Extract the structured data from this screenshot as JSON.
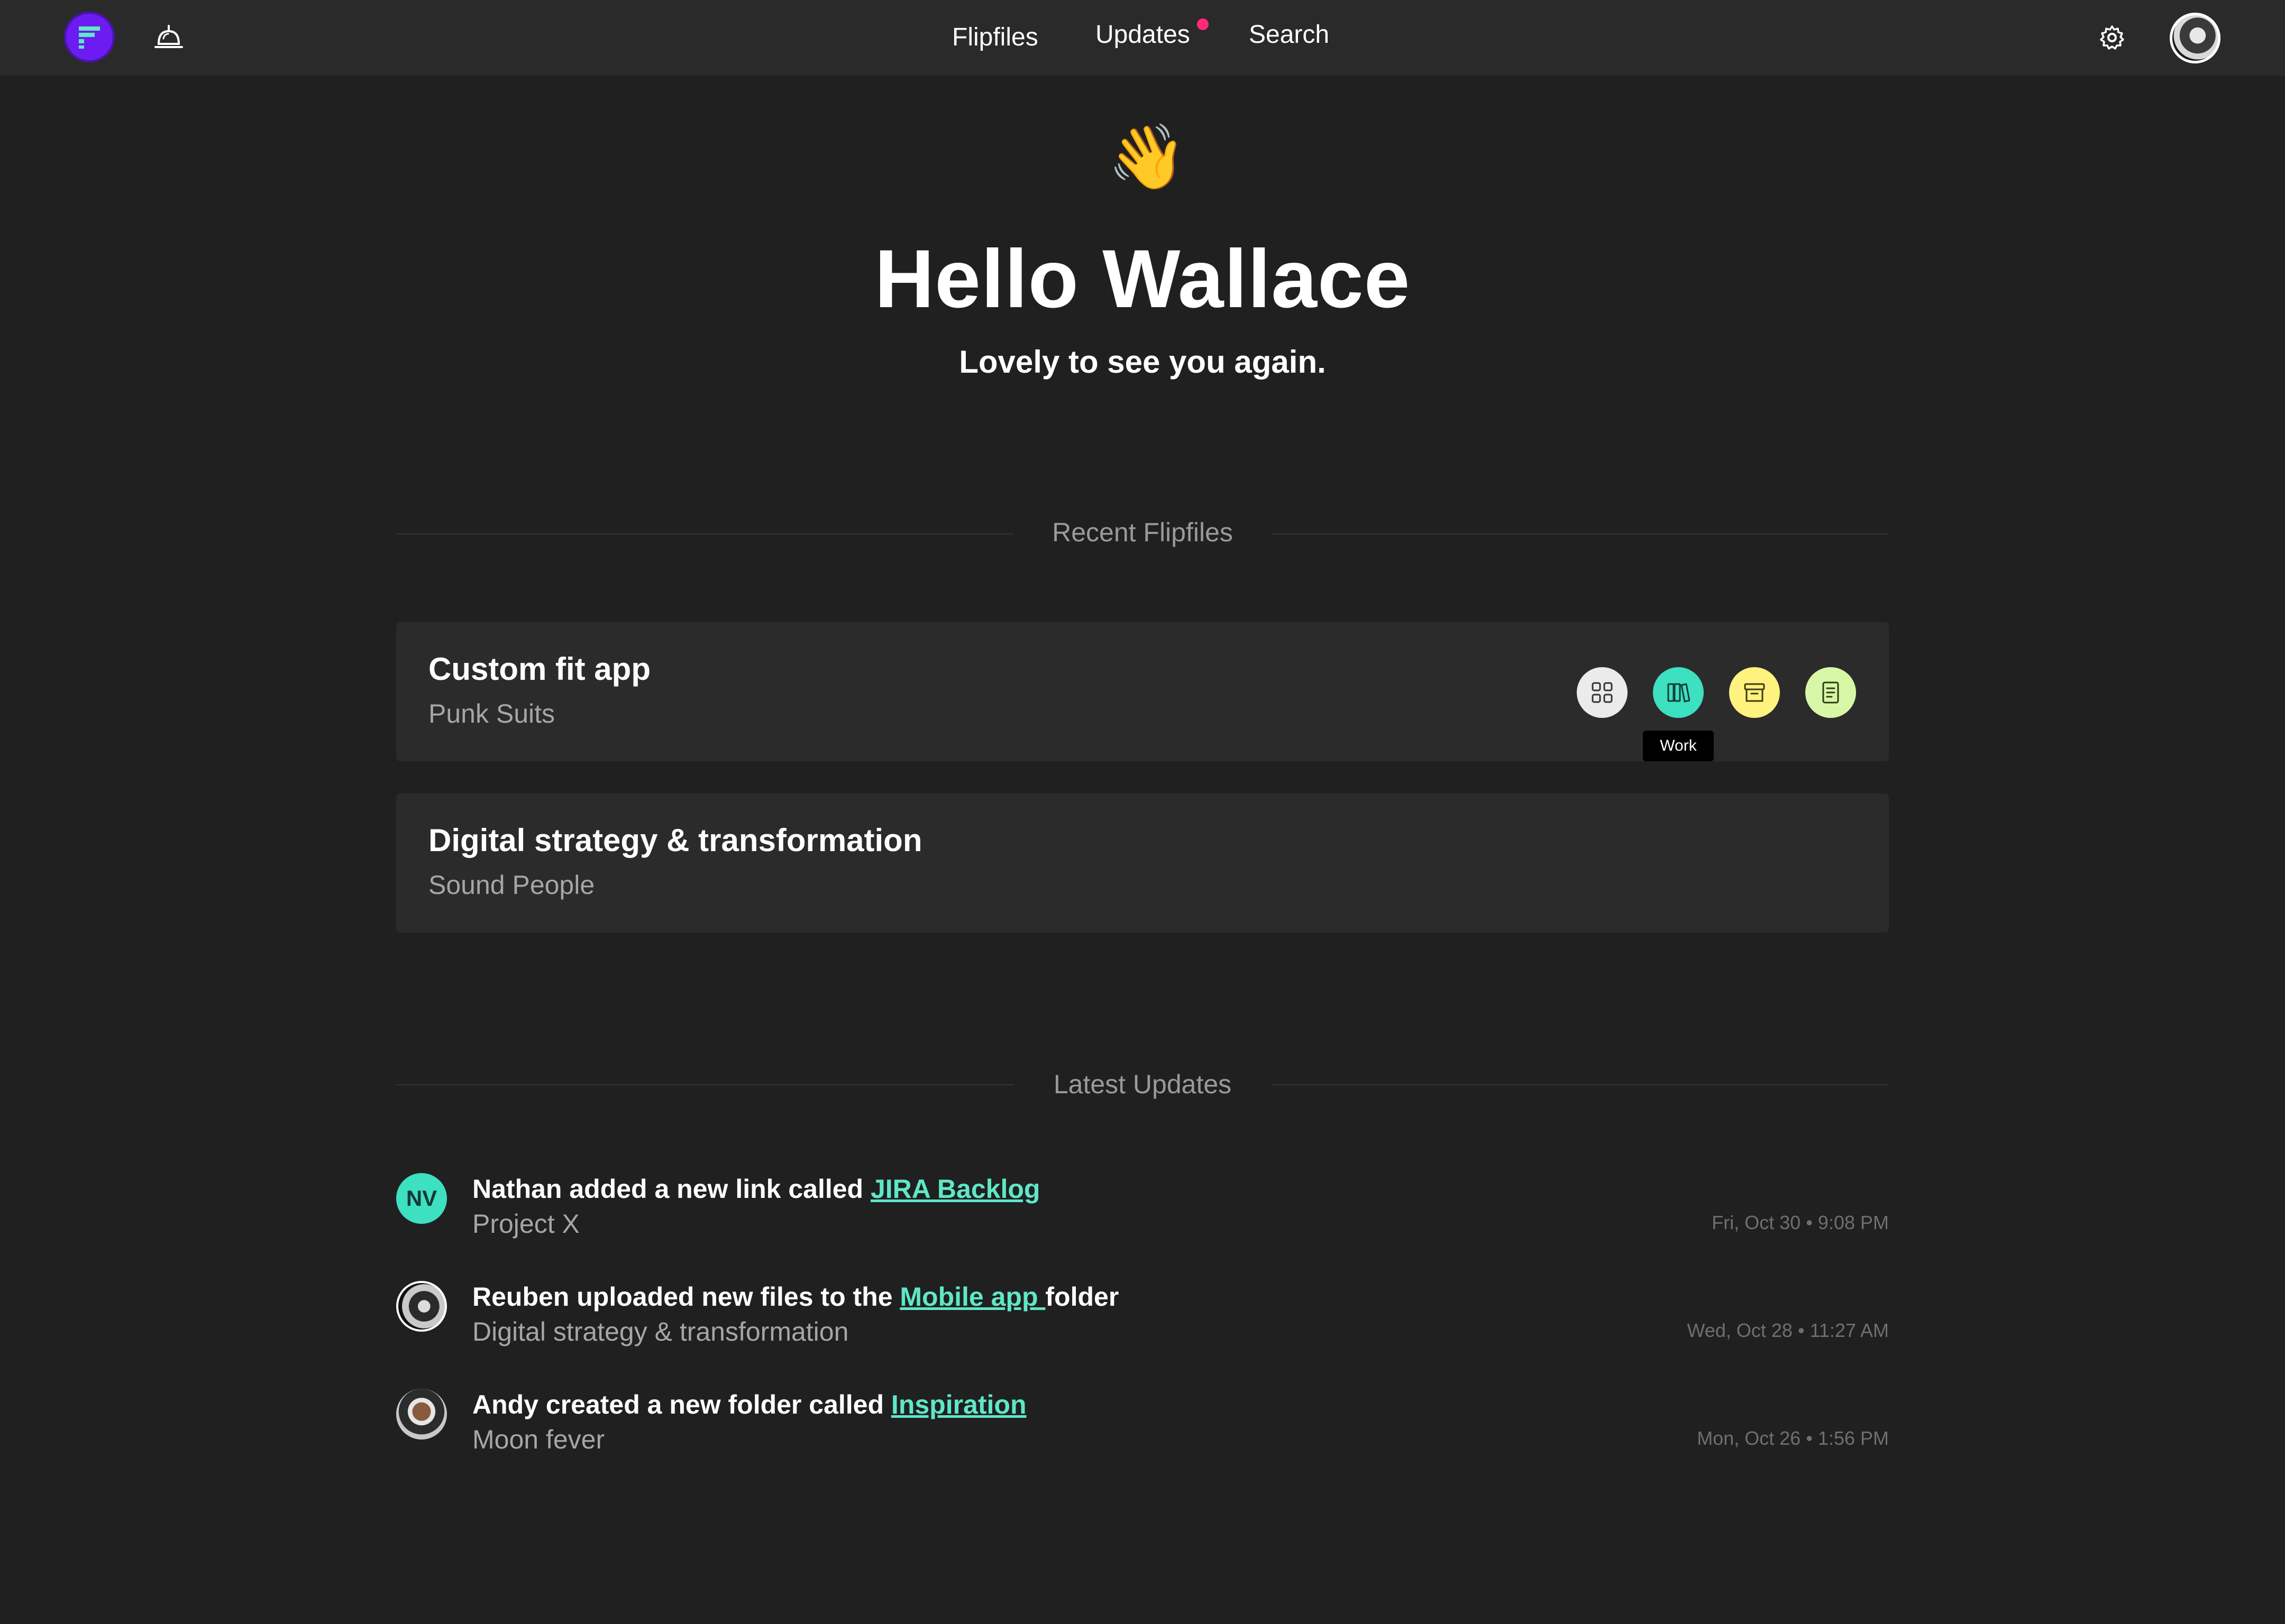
{
  "nav": {
    "flipfiles": "Flipfiles",
    "updates": "Updates",
    "search": "Search",
    "has_new_updates": true
  },
  "icons": {
    "logo": "flipfiles-logo-icon",
    "bell": "bell-icon",
    "settings": "gear-icon",
    "avatar": "user-avatar"
  },
  "hero": {
    "emoji": "👋",
    "greeting": "Hello Wallace",
    "subtitle": "Lovely to see you again."
  },
  "recent": {
    "title": "Recent Flipfiles",
    "cards": [
      {
        "title": "Custom fit app",
        "client": "Punk Suits",
        "actions": [
          {
            "name": "overview",
            "icon": "grid-icon",
            "color": "#ebebeb"
          },
          {
            "name": "work",
            "icon": "books-icon",
            "color": "#3de0c0"
          },
          {
            "name": "archive",
            "icon": "archive-box-icon",
            "color": "#fff27e"
          },
          {
            "name": "notes",
            "icon": "document-icon",
            "color": "#d8f7a6"
          }
        ],
        "tooltip": "Work"
      },
      {
        "title": "Digital strategy & transformation",
        "client": "Sound People"
      }
    ]
  },
  "updates": {
    "title": "Latest Updates",
    "items": [
      {
        "avatar_initials": "NV",
        "text_before": "Nathan added a new link called ",
        "link": "JIRA Backlog",
        "text_after": "",
        "project": "Project X",
        "time": "Fri, Oct 30 • 9:08 PM"
      },
      {
        "avatar_initials": "",
        "text_before": "Reuben uploaded new files to the ",
        "link": "Mobile app ",
        "text_after": "folder",
        "project": "Digital strategy & transformation",
        "time": "Wed, Oct 28 • 11:27 AM"
      },
      {
        "avatar_initials": "",
        "text_before": "Andy created a new folder called ",
        "link": "Inspiration",
        "text_after": "",
        "project": "Moon fever",
        "time": "Mon, Oct 26 • 1:56 PM"
      }
    ]
  },
  "colors": {
    "background": "#202020",
    "topbar": "#2a2a2a",
    "card": "#2b2b2b",
    "accent": "#5fe7c8",
    "brand": "#6c1cf0",
    "notification": "#ff2a7a"
  }
}
